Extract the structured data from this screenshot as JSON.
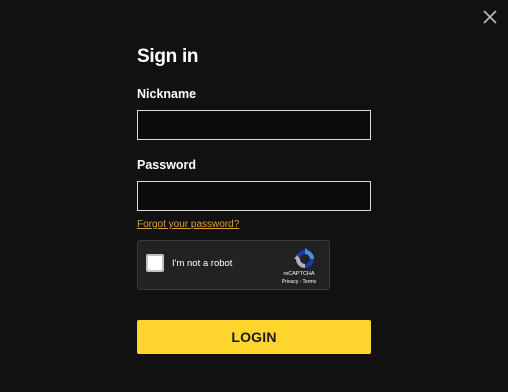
{
  "modal": {
    "title": "Sign in",
    "close_icon": "close-icon"
  },
  "form": {
    "nickname_label": "Nickname",
    "nickname_value": "",
    "password_label": "Password",
    "password_value": "",
    "forgot_link": "Forgot your password?",
    "login_label": "LOGIN"
  },
  "captcha": {
    "checkbox_label": "I'm not a robot",
    "brand": "reCAPTCHA",
    "links": "Privacy - Terms",
    "logo_icon": "recaptcha-logo-icon"
  },
  "colors": {
    "background": "#111111",
    "accent": "#ffd52e",
    "link": "#e0a030"
  }
}
